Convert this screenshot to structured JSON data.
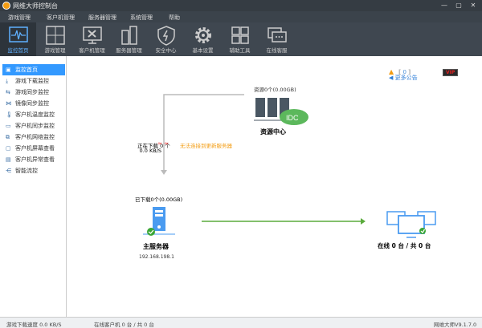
{
  "window": {
    "title": "网维大师控制台",
    "minimize": "—",
    "maximize": "▢",
    "close": "✕"
  },
  "menu": [
    "游戏管理",
    "客户机管理",
    "服务器管理",
    "系统管理",
    "帮助"
  ],
  "toolbar": [
    {
      "label": "监控首页",
      "icon": "monitor-pulse-icon",
      "active": true
    },
    {
      "label": "游戏管理",
      "icon": "game-grid-icon"
    },
    {
      "label": "客户机管理",
      "icon": "client-monitor-tools-icon"
    },
    {
      "label": "服务器管理",
      "icon": "server-icon"
    },
    {
      "label": "安全中心",
      "icon": "shield-icon"
    },
    {
      "label": "基本设置",
      "icon": "gear-icon"
    },
    {
      "label": "辅助工具",
      "icon": "tiles-icon"
    },
    {
      "label": "在线客服",
      "icon": "chat-icon"
    }
  ],
  "alerts": {
    "open": "[",
    "count": "0",
    "close": "]"
  },
  "vip": "VIP",
  "sidebar": [
    {
      "label": "监控首页",
      "icon": "home-icon",
      "active": true
    },
    {
      "label": "游戏下载监控",
      "icon": "download-icon"
    },
    {
      "label": "游戏同步监控",
      "icon": "sync-icon"
    },
    {
      "label": "镜像同步监控",
      "icon": "mirror-icon"
    },
    {
      "label": "客户机温度监控",
      "icon": "thermometer-icon"
    },
    {
      "label": "客户机同步监控",
      "icon": "monitor-icon"
    },
    {
      "label": "客户机网络监控",
      "icon": "network-icon"
    },
    {
      "label": "客户机屏幕查看",
      "icon": "screen-icon"
    },
    {
      "label": "客户机异常查看",
      "icon": "alert-screen-icon"
    },
    {
      "label": "智能流控",
      "icon": "flow-icon"
    }
  ],
  "main": {
    "notice": "更多公告",
    "resource_count": "资源0个(0.00GB)",
    "resource_center": "资源中心",
    "idc": "IDC",
    "downloading": "正在下载 0 个",
    "speed": "0.0 KB/S",
    "error": "无法连接到更新服务器",
    "downloaded": "已下载0个(0.00GB)",
    "main_server": "主服务器",
    "server_ip": "192.168.198.1",
    "online": "在线 0 台 / 共 0 台"
  },
  "status": {
    "download_speed": "游戏下载速度 0.0 KB/S",
    "clients": "在线客户机 0 台 / 共 0 台",
    "version": "网维大师V9.1.7.0"
  },
  "colors": {
    "accent": "#3399ff",
    "error": "#f39c12",
    "link": "#4caf50"
  }
}
